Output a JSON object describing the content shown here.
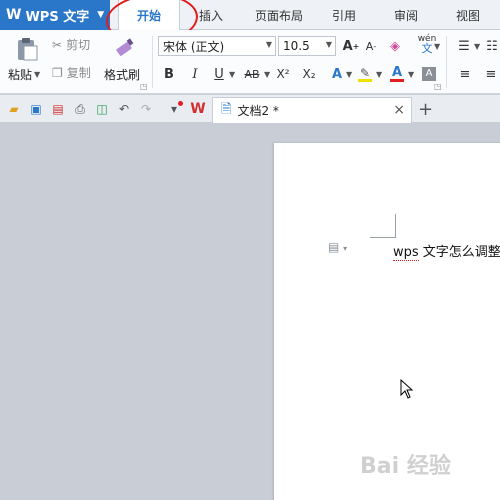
{
  "app": {
    "name": "WPS 文字",
    "logo": "W"
  },
  "tabs": [
    {
      "label": "开始",
      "active": true
    },
    {
      "label": "插入",
      "active": false
    },
    {
      "label": "页面布局",
      "active": false
    },
    {
      "label": "引用",
      "active": false
    },
    {
      "label": "审阅",
      "active": false
    },
    {
      "label": "视图",
      "active": false
    }
  ],
  "ribbon": {
    "paste_label": "粘贴",
    "cut_label": "剪切",
    "copy_label": "复制",
    "format_painter_label": "格式刷",
    "font_name": "宋体 (正文)",
    "font_size": "10.5",
    "bold": "B",
    "italic": "I",
    "underline": "U",
    "strike": "AB",
    "superscript": "X²",
    "subscript": "X₂",
    "wen": "wén"
  },
  "document": {
    "tab_name": "文档2 *",
    "text_prefix": "wps",
    "text_rest": " 文字怎么调整"
  },
  "watermark": "Bai 经验",
  "colors": {
    "accent": "#2a77c9",
    "annotation": "#e01b1b",
    "font_color_bar": "#e02020",
    "highlight_bar": "#f0e000"
  }
}
